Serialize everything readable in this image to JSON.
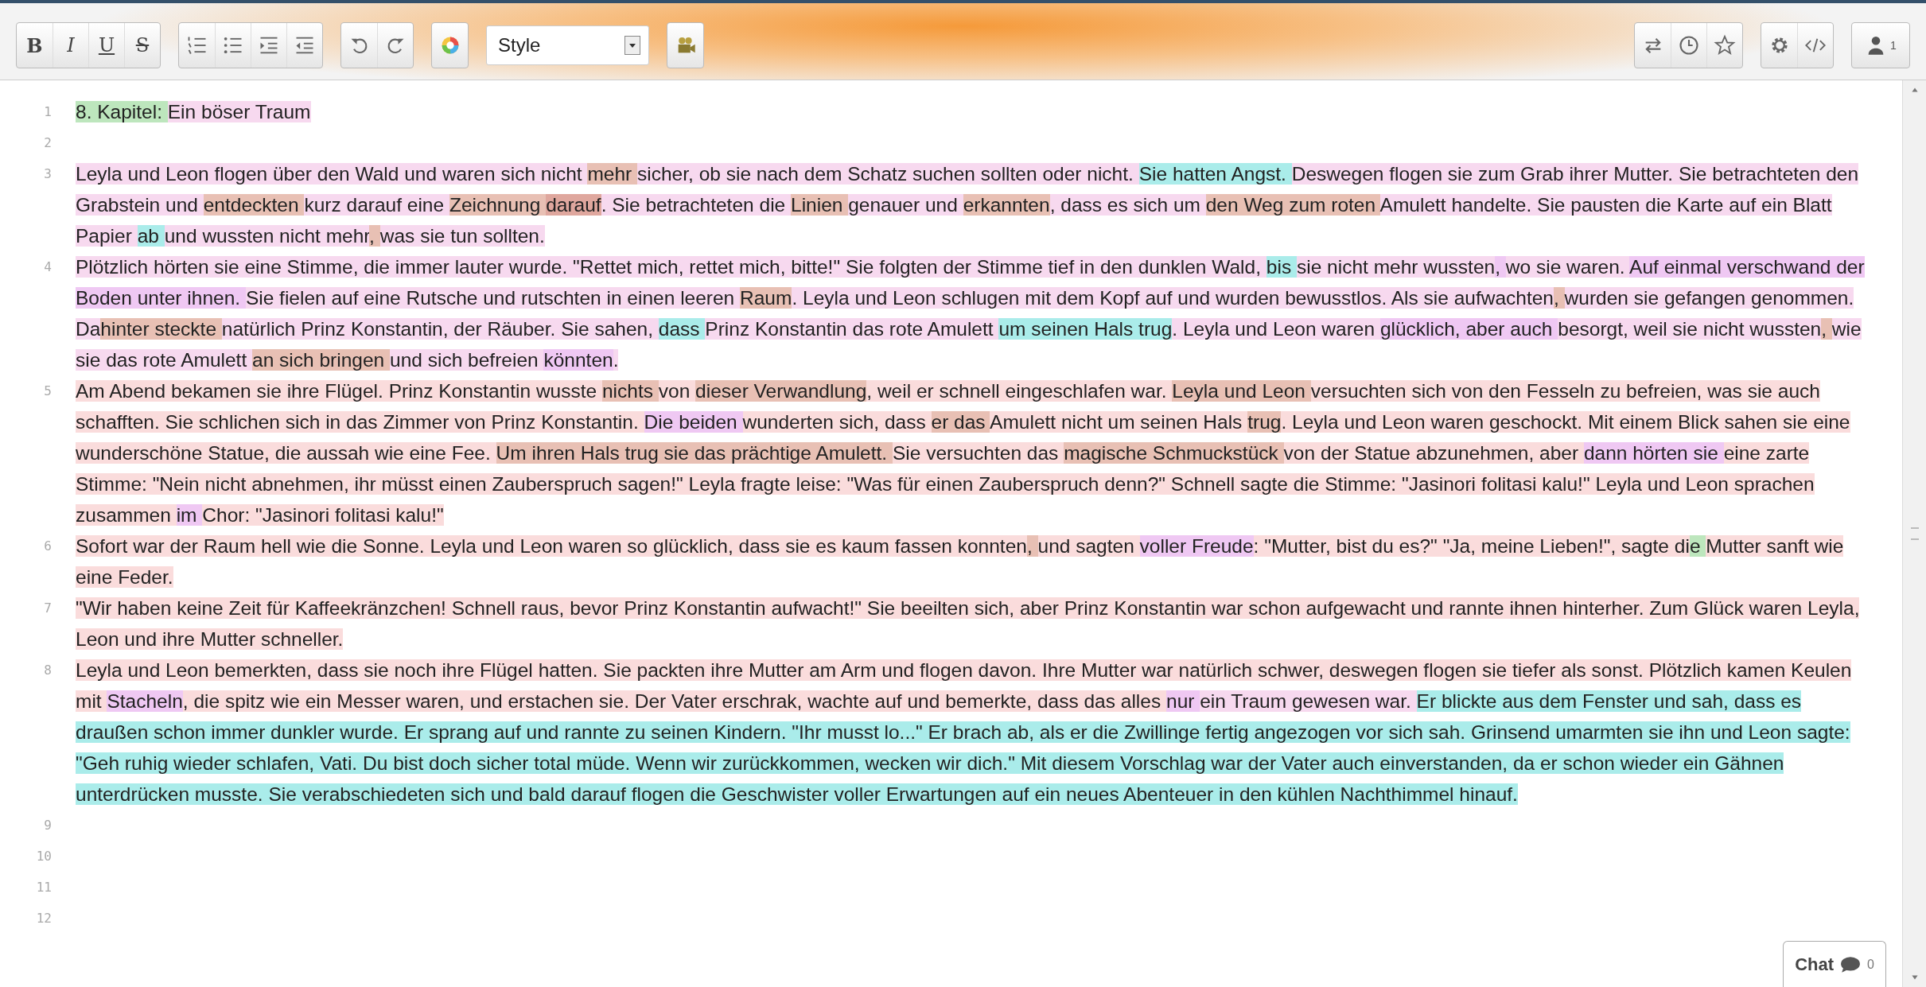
{
  "toolbar": {
    "format_buttons": [
      {
        "kind": "bold",
        "label": "B"
      },
      {
        "kind": "italic",
        "label": "I"
      },
      {
        "kind": "underline",
        "label": "U"
      },
      {
        "kind": "strike",
        "label": "S"
      }
    ],
    "style_select": {
      "value": "Style"
    },
    "user_count": "1"
  },
  "lines": [
    {
      "number": "1",
      "segments": [
        {
          "text": "8. Kapitel: ",
          "color": "#bde6bd"
        },
        {
          "text": "Ein böser Traum",
          "color": "#f7d9ef"
        }
      ]
    },
    {
      "number": "2"
    },
    {
      "number": "3",
      "segments": [
        {
          "text": "Leyla und Leon flogen über den Wald und waren sich nicht ",
          "color": "#f7d9ef"
        },
        {
          "text": "mehr",
          "color": "#e8c0b4"
        },
        {
          "text": " sicher, ob sie nach dem Schatz suchen sollten oder nicht. ",
          "color": "#f7d9ef"
        },
        {
          "text": "Sie hatten Angst.",
          "color": "#aaecea"
        },
        {
          "text": " Deswegen flogen sie zum Grab ihrer Mutter. Sie betrachteten den Grabstein und ",
          "color": "#f7d9ef"
        },
        {
          "text": "entdeckten",
          "color": "#e8c0b4"
        },
        {
          "text": " kurz darauf eine ",
          "color": "#f7d9ef"
        },
        {
          "text": "Zeichnung ",
          "color": "#e8c0b4"
        },
        {
          "text": "darauf",
          "color": "#dfa79e"
        },
        {
          "text": ". Sie betrachteten die ",
          "color": "#f7d9ef"
        },
        {
          "text": "Linien",
          "color": "#e8c0b4"
        },
        {
          "text": " genauer und ",
          "color": "#f7d9ef"
        },
        {
          "text": "erkannten",
          "color": "#e8c0b4"
        },
        {
          "text": ", dass es sich um ",
          "color": "#f7d9ef"
        },
        {
          "text": "den Weg zum roten",
          "color": "#e8c0b4"
        },
        {
          "text": " Amulett handelte. Sie pausten die Karte auf ein Blatt Papier ",
          "color": "#f7d9ef"
        },
        {
          "text": "ab",
          "color": "#aaecea"
        },
        {
          "text": " und wussten nicht mehr",
          "color": "#f7d9ef"
        },
        {
          "text": ",",
          "color": "#e8c0b4"
        },
        {
          "text": " was sie tun sollten.",
          "color": "#f7d9ef"
        }
      ]
    },
    {
      "number": "4",
      "segments": [
        {
          "text": "Plötzlich hörten sie eine Stimme, die immer lauter wurde. \"Rettet mich, rettet mich, bitte!\" Sie folgten der Stimme tief in den dunklen Wald, ",
          "color": "#f7d9ef"
        },
        {
          "text": "bis",
          "color": "#aaecea"
        },
        {
          "text": " sie nicht mehr wussten",
          "color": "#f7d9ef"
        },
        {
          "text": ",",
          "color": "#efc8f3"
        },
        {
          "text": " wo sie waren. ",
          "color": "#f7d9ef"
        },
        {
          "text": "Auf einmal verschwand der Boden unter ihnen.",
          "color": "#efc8f3"
        },
        {
          "text": " Sie fielen auf eine Rutsche und rutschten in einen leeren ",
          "color": "#f7d9ef"
        },
        {
          "text": "Raum",
          "color": "#e8c0b4"
        },
        {
          "text": ". Leyla und Leon schlugen mit dem Kopf auf und wurden bewusstlos. Als sie aufwachten",
          "color": "#f7d9ef"
        },
        {
          "text": ",",
          "color": "#e8c0b4"
        },
        {
          "text": " wurden sie gefangen genommen. Da",
          "color": "#f7d9ef"
        },
        {
          "text": "hinter steckte",
          "color": "#e8c0b4"
        },
        {
          "text": " natürlich Prinz Konstantin, der Räuber. Sie sahen, ",
          "color": "#f7d9ef"
        },
        {
          "text": "dass",
          "color": "#aaecea"
        },
        {
          "text": " Prinz Konstantin das rote Amulett ",
          "color": "#f7d9ef"
        },
        {
          "text": "um seinen Hals trug",
          "color": "#aaecea"
        },
        {
          "text": ". Leyla und Leon waren ",
          "color": "#f7d9ef"
        },
        {
          "text": "glücklich, aber auch",
          "color": "#efc8f3"
        },
        {
          "text": " besorgt, weil sie nicht wussten",
          "color": "#f7d9ef"
        },
        {
          "text": ",",
          "color": "#e8c0b4"
        },
        {
          "text": " wie sie das rote Amulett ",
          "color": "#f7d9ef"
        },
        {
          "text": "an sich bringen",
          "color": "#e8c0b4"
        },
        {
          "text": " und sich befreien ",
          "color": "#f7d9ef"
        },
        {
          "text": "könnten",
          "color": "#efc8f3"
        },
        {
          "text": ".",
          "color": "#f7d9ef"
        }
      ]
    },
    {
      "number": "5",
      "segments": [
        {
          "text": "Am Abend bekamen sie ihre Flügel. Prinz Konstantin wusste ",
          "color": "#fadcdc"
        },
        {
          "text": "nichts",
          "color": "#e8c0b4"
        },
        {
          "text": " von ",
          "color": "#fadcdc"
        },
        {
          "text": "dieser Verwandlung",
          "color": "#e8c0b4"
        },
        {
          "text": ", weil er schnell eingeschlafen war. ",
          "color": "#fadcdc"
        },
        {
          "text": "Leyla und Leon",
          "color": "#e8c0b4"
        },
        {
          "text": " versuchten sich von den Fesseln zu befreien, was sie auch schafften. Sie schlichen sich in das Zimmer von Prinz Konstantin. ",
          "color": "#fadcdc"
        },
        {
          "text": "Die beiden",
          "color": "#efc8f3"
        },
        {
          "text": " wunderten sich, dass ",
          "color": "#fadcdc"
        },
        {
          "text": "er das",
          "color": "#e8c0b4"
        },
        {
          "text": " Amulett nicht um seinen Hals ",
          "color": "#fadcdc"
        },
        {
          "text": "trug",
          "color": "#e8c0b4"
        },
        {
          "text": ". Leyla und Leon waren geschockt. Mit einem Blick sahen sie eine wunderschöne Statue, die aussah wie eine Fee. ",
          "color": "#fadcdc"
        },
        {
          "text": "Um ihren Hals trug sie das prächtige Amulett.",
          "color": "#e8c0b4"
        },
        {
          "text": " Sie versuchten das ",
          "color": "#fadcdc"
        },
        {
          "text": "magische Schmuckstück",
          "color": "#e8c0b4"
        },
        {
          "text": " von der Statue abzunehmen, aber ",
          "color": "#fadcdc"
        },
        {
          "text": "dann hörten sie",
          "color": "#efc8f3"
        },
        {
          "text": " eine zarte Stimme: \"Nein nicht abnehmen, ihr müsst einen Zauberspruch sagen!\" Leyla fragte leise: \"Was für einen Zauberspruch denn?\" Schnell sagte die Stimme: \"Jasinori folitasi kalu!\" Leyla und Leon sprachen zusammen ",
          "color": "#fadcdc"
        },
        {
          "text": "im",
          "color": "#efc8f3"
        },
        {
          "text": " Chor: \"Jasinori folitasi kalu!\"",
          "color": "#fadcdc"
        }
      ]
    },
    {
      "number": "6",
      "segments": [
        {
          "text": "Sofort war der Raum hell wie die Sonne. Leyla und Leon waren so glücklich, dass sie es kaum fassen konnten",
          "color": "#fadcdc"
        },
        {
          "text": ",",
          "color": "#e8c0b4"
        },
        {
          "text": " und sagten ",
          "color": "#fadcdc"
        },
        {
          "text": "voller Freude",
          "color": "#efc8f3"
        },
        {
          "text": ": \"Mutter, bist du es?\" \"Ja, meine Lieben!\", sagte di",
          "color": "#fadcdc"
        },
        {
          "text": "e",
          "color": "#bde6bd"
        },
        {
          "text": " Mutter sanft wie eine Feder.",
          "color": "#fadcdc"
        }
      ]
    },
    {
      "number": "7",
      "segments": [
        {
          "text": "\"Wir haben keine Zeit für Kaffeekränzchen! Schnell raus, bevor Prinz Konstantin aufwacht!\" Sie beeilten sich, aber Prinz Konstantin war schon aufgewacht und rannte ihnen hinterher. Zum Glück waren Leyla, Leon und ihre Mutter schneller.",
          "color": "#fadcdc"
        }
      ]
    },
    {
      "number": "8",
      "segments": [
        {
          "text": "Leyla und Leon bemerkten, dass sie noch ihre Flügel hatten. Sie packten ihre Mutter am Arm und flogen davon. Ihre Mutter war natürlich schwer, deswegen flogen sie tiefer als sonst. Plötzlich kamen Keulen mit ",
          "color": "#fadcdc"
        },
        {
          "text": "Stacheln",
          "color": "#efc8f3"
        },
        {
          "text": ", die spitz wie ein Messer waren, und erstachen sie. Der Vater erschrak, wachte auf und bemerkte, dass das alles ",
          "color": "#fadcdc"
        },
        {
          "text": "nur",
          "color": "#efc8f3"
        },
        {
          "text": " ein Traum gewesen war.",
          "color": "#f7d9ef"
        },
        {
          "text": " Er blickte aus dem Fenster und sah, dass es draußen schon immer dunkler wurde. Er sprang auf und rannte zu seinen Kindern. \"Ihr musst lo...\" Er brach ab, als er die Zwillinge fertig angezogen vor sich sah. Grinsend umarmten sie ihn und Leon sagte: \"Geh ruhig wieder schlafen, Vati. Du bist doch sicher total müde. Wenn wir zurückkommen, wecken wir dich.\" Mit diesem Vorschlag war der Vater auch einverstanden, da er schon wieder ein Gähnen unterdrücken musste. Sie verabschiedeten sich und bald darauf flogen die Geschwister voller Erwartungen auf ein neues Abenteuer in den kühlen Nachthimmel hinauf.",
          "color": "#aaecea"
        }
      ]
    },
    {
      "number": "9"
    },
    {
      "number": "10"
    },
    {
      "number": "11"
    },
    {
      "number": "12"
    }
  ],
  "chat": {
    "label": "Chat",
    "count": "0"
  }
}
